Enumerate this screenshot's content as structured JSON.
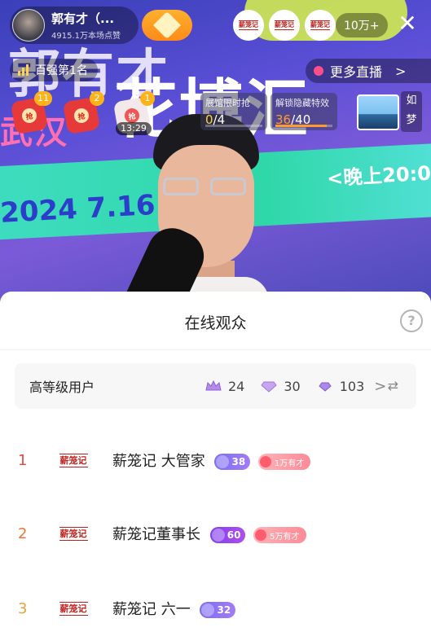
{
  "host": {
    "name": "郭有才（...",
    "subtitle": "4915.1万本场点赞"
  },
  "viewer_count": "10万+",
  "rank_label": "百强第1名",
  "more_live_label": "更多直播",
  "viewer_avatar_brand": "薪笼记",
  "red_packets": [
    {
      "count": "11",
      "seal": "抢"
    },
    {
      "count": "2",
      "seal": "抢"
    },
    {
      "count": "1",
      "seal": "抢",
      "timer": "13:29"
    }
  ],
  "tasks": [
    {
      "title": "展馆限时抢",
      "current": "0",
      "total": "/4",
      "progress": 0.0
    },
    {
      "title": "解锁隐藏特效",
      "current": "36",
      "total": "/40",
      "progress": 0.9
    }
  ],
  "side_text": [
    "如",
    "梦"
  ],
  "stream_banner": {
    "line1": "郭有才",
    "line2": "花博汇",
    "line3": "武汉",
    "date": "2024 7.16日",
    "time": "<晚上20:0"
  },
  "sheet": {
    "title": "在线观众",
    "help_icon": "?",
    "tier_label": "高等级用户",
    "tier_stats": [
      {
        "icon": "crown-icon",
        "value": "24"
      },
      {
        "icon": "gem-icon",
        "value": "30"
      },
      {
        "icon": "gem-small-icon",
        "value": "103"
      }
    ],
    "tier_chevron": ">",
    "swap_icon": "⇄",
    "users": [
      {
        "rank": "1",
        "logo": "薪笼记",
        "name": "薪笼记 大管家",
        "level": "38",
        "level_style": "blue",
        "fan": "1万有才"
      },
      {
        "rank": "2",
        "logo": "薪笼记",
        "name": "薪笼记董事长",
        "level": "60",
        "level_style": "purple",
        "fan": "5万有才"
      },
      {
        "rank": "3",
        "logo": "薪笼记",
        "name": "薪笼记 六一",
        "level": "32",
        "level_style": "blue",
        "fan": ""
      }
    ]
  },
  "colors": {
    "accent_red": "#e74b3c",
    "follow_orange": "#ff8b19",
    "level_purple": "#7e3ff2"
  }
}
